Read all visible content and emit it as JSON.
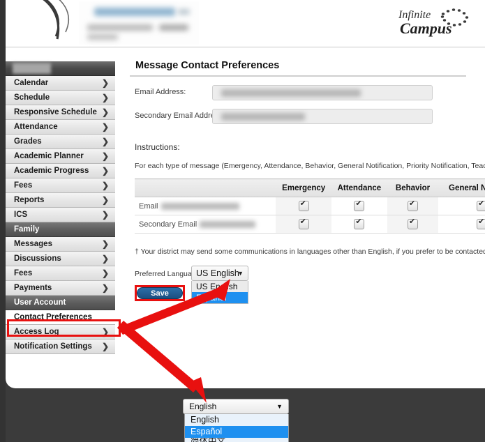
{
  "header": {
    "brand_name": "Infinite Campus",
    "brand_line1": "Infinite",
    "brand_line2": "Campus",
    "district_block_label": "district-logo-redacted"
  },
  "sidebar": {
    "student_name_redacted": "",
    "items": [
      {
        "label": "Calendar",
        "type": "item",
        "chevron": "❯"
      },
      {
        "label": "Schedule",
        "type": "item",
        "chevron": "❯"
      },
      {
        "label": "Responsive Schedule",
        "type": "item",
        "chevron": "❯"
      },
      {
        "label": "Attendance",
        "type": "item",
        "chevron": "❯"
      },
      {
        "label": "Grades",
        "type": "item",
        "chevron": "❯"
      },
      {
        "label": "Academic Planner",
        "type": "item",
        "chevron": "❯"
      },
      {
        "label": "Academic Progress",
        "type": "item",
        "chevron": "❯"
      },
      {
        "label": "Fees",
        "type": "item",
        "chevron": "❯"
      },
      {
        "label": "Reports",
        "type": "item",
        "chevron": "❯"
      },
      {
        "label": "ICS",
        "type": "item",
        "chevron": "❯"
      },
      {
        "label": "Family",
        "type": "header",
        "chevron": ""
      },
      {
        "label": "Messages",
        "type": "item",
        "chevron": "❯"
      },
      {
        "label": "Discussions",
        "type": "item",
        "chevron": "❯"
      },
      {
        "label": "Fees",
        "type": "item",
        "chevron": "❯"
      },
      {
        "label": "Payments",
        "type": "item",
        "chevron": "❯"
      },
      {
        "label": "User Account",
        "type": "header",
        "chevron": ""
      },
      {
        "label": "Contact Preferences",
        "type": "selected",
        "chevron": ""
      },
      {
        "label": "Access Log",
        "type": "item",
        "chevron": "❯"
      },
      {
        "label": "Notification Settings",
        "type": "item",
        "chevron": "❯"
      }
    ]
  },
  "main": {
    "page_title": "Message Contact Preferences",
    "email_label": "Email Address:",
    "email_value": "",
    "secondary_email_label": "Secondary Email Address:",
    "secondary_email_value": "",
    "instructions_heading": "Instructions:",
    "instructions_body": "For each type of message (Emergency, Attendance, Behavior, General Notification, Priority Notification, Teacher) select how",
    "footnote": "† Your district may send some communications in languages other than English, if you prefer to be contacted in a another la",
    "table": {
      "columns": [
        "",
        "Emergency",
        "Attendance",
        "Behavior",
        "General Notificati"
      ],
      "rows": [
        {
          "label": "Email",
          "value_redacted": "",
          "checks": [
            true,
            true,
            true,
            true
          ]
        },
        {
          "label": "Secondary Email",
          "value_redacted": "",
          "checks": [
            true,
            true,
            true,
            true
          ]
        }
      ]
    },
    "language": {
      "label": "Preferred Language",
      "selected": "US English",
      "caret": "▼",
      "options": [
        {
          "label": "US English",
          "selected": false
        },
        {
          "label": "Español",
          "selected": true
        }
      ]
    },
    "save_label": "Save"
  },
  "bottom_select": {
    "selected": "English",
    "caret": "▼",
    "options": [
      {
        "label": "English",
        "selected": false
      },
      {
        "label": "Español",
        "selected": true
      },
      {
        "label": "简体中文",
        "selected": false
      }
    ]
  },
  "annotations": {
    "highlight_color": "#e8100f",
    "arrow_color": "#e8100f",
    "highlighted_item": "Contact Preferences",
    "highlighted_button": "Save"
  }
}
